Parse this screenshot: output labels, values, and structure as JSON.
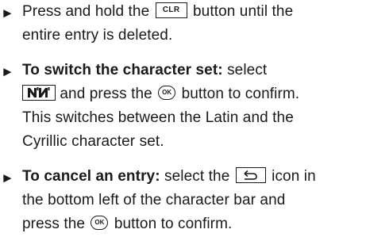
{
  "bullet_glyph": "►",
  "items": [
    {
      "lines": [
        {
          "pre": "Press and hold the ",
          "icon_text": "CLR",
          "post": " button until the"
        },
        {
          "text": "entire entry is deleted."
        }
      ]
    },
    {
      "heading": "To switch the character set:",
      "lines": [
        {
          "after_heading": " select"
        },
        {
          "icon": "character-set-icon",
          "post": " and press the ",
          "ok_text": "OK",
          "post2": " button to confirm."
        },
        {
          "text": "This switches between the Latin and the"
        },
        {
          "text": "Cyrillic character set."
        }
      ]
    },
    {
      "heading": "To cancel an entry:",
      "lines": [
        {
          "after_heading": " select the ",
          "icon": "back-icon",
          "post": " icon in"
        },
        {
          "text": "the bottom left of the character bar and"
        },
        {
          "pre": "press the ",
          "ok_text": "OK",
          "post": " button to confirm."
        }
      ]
    }
  ]
}
